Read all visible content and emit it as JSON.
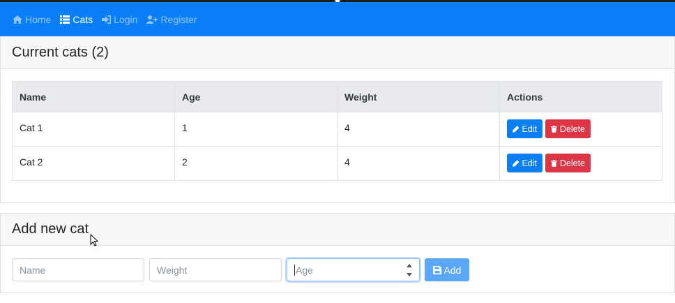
{
  "navbar": {
    "items": [
      {
        "label": "Home",
        "icon": "home-icon"
      },
      {
        "label": "Cats",
        "icon": "list-icon",
        "active": true
      },
      {
        "label": "Login",
        "icon": "sign-in-icon"
      },
      {
        "label": "Register",
        "icon": "user-plus-icon"
      }
    ],
    "color": "#0a7ef7"
  },
  "cats_card": {
    "title": "Current cats (2)",
    "columns": [
      "Name",
      "Age",
      "Weight",
      "Actions"
    ],
    "rows": [
      {
        "name": "Cat 1",
        "age": "1",
        "weight": "4"
      },
      {
        "name": "Cat 2",
        "age": "2",
        "weight": "4"
      }
    ],
    "edit_label": "Edit",
    "delete_label": "Delete"
  },
  "add_card": {
    "title": "Add new cat",
    "name_placeholder": "Name",
    "weight_placeholder": "Weight",
    "age_placeholder": "Age",
    "add_label": "Add"
  },
  "colors": {
    "primary": "#0a7ef7",
    "danger": "#dc3545",
    "add_disabled": "#5aa7f7"
  }
}
